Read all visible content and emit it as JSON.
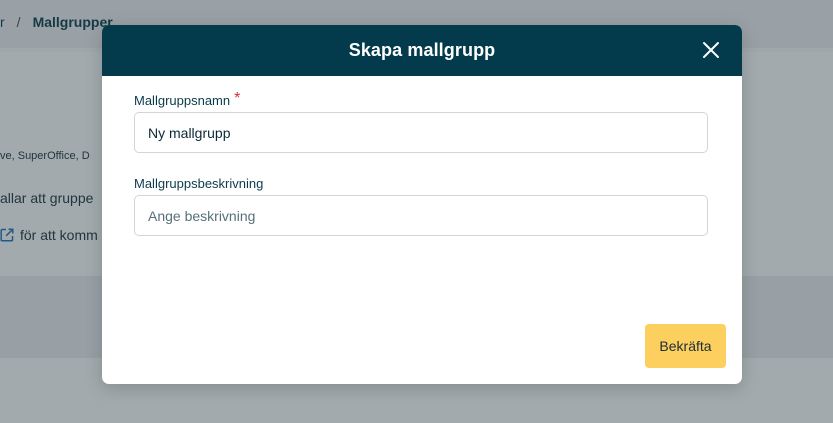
{
  "background": {
    "breadcrumb": {
      "prev": "r",
      "separator": "/",
      "current": "Mallgrupper"
    },
    "line1": "ve, SuperOffice, D",
    "line2": "allar att gruppe",
    "line3": "för att komm",
    "edit_icon": "external-edit-icon"
  },
  "modal": {
    "title": "Skapa mallgrupp",
    "close_icon": "close-icon",
    "name_field": {
      "label": "Mallgruppsnamn",
      "required_mark": "*",
      "value": "Ny mallgrupp"
    },
    "description_field": {
      "label": "Mallgruppsbeskrivning",
      "value": "",
      "placeholder": "Ange beskrivning"
    },
    "confirm_label": "Bekräfta"
  },
  "colors": {
    "header": "#033a4c",
    "confirm_button": "#fdcf5f",
    "required": "#d6303a"
  }
}
